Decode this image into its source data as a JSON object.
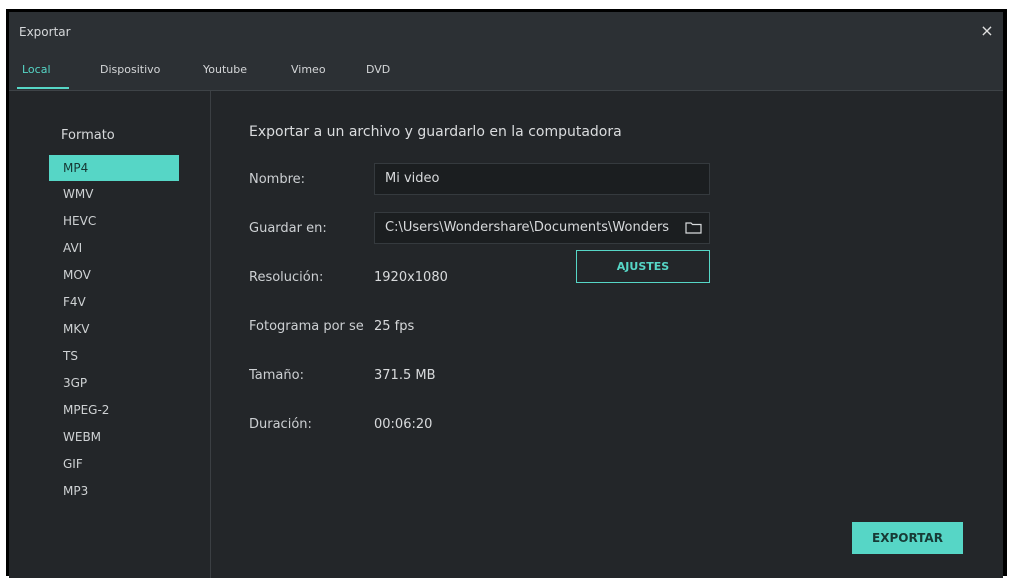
{
  "window": {
    "title": "Exportar",
    "close_glyph": "×"
  },
  "tabs": [
    {
      "label": "Local",
      "active": true
    },
    {
      "label": "Dispositivo",
      "active": false
    },
    {
      "label": "Youtube",
      "active": false
    },
    {
      "label": "Vimeo",
      "active": false
    },
    {
      "label": "DVD",
      "active": false
    }
  ],
  "sidebar": {
    "heading": "Formato",
    "formats": [
      "MP4",
      "WMV",
      "HEVC",
      "AVI",
      "MOV",
      "F4V",
      "MKV",
      "TS",
      "3GP",
      "MPEG-2",
      "WEBM",
      "GIF",
      "MP3"
    ],
    "selected": "MP4"
  },
  "main": {
    "heading": "Exportar a un archivo y guardarlo en la computadora",
    "name_label": "Nombre:",
    "name_value": "Mi video",
    "save_label": "Guardar en:",
    "save_path": "C:\\Users\\Wondershare\\Documents\\Wonders",
    "folder_icon": "folder-icon",
    "resolution_label": "Resolución:",
    "resolution_value": "1920x1080",
    "settings_button": "AJUSTES",
    "framerate_label": "Fotograma por se",
    "framerate_value": "25 fps",
    "size_label": "Tamaño:",
    "size_value": "371.5 MB",
    "duration_label": "Duración:",
    "duration_value": "00:06:20",
    "export_button": "EXPORTAR"
  },
  "colors": {
    "accent": "#56d6c6",
    "background": "#232629",
    "titlebar": "#2c3034",
    "input": "#1b1e20"
  }
}
